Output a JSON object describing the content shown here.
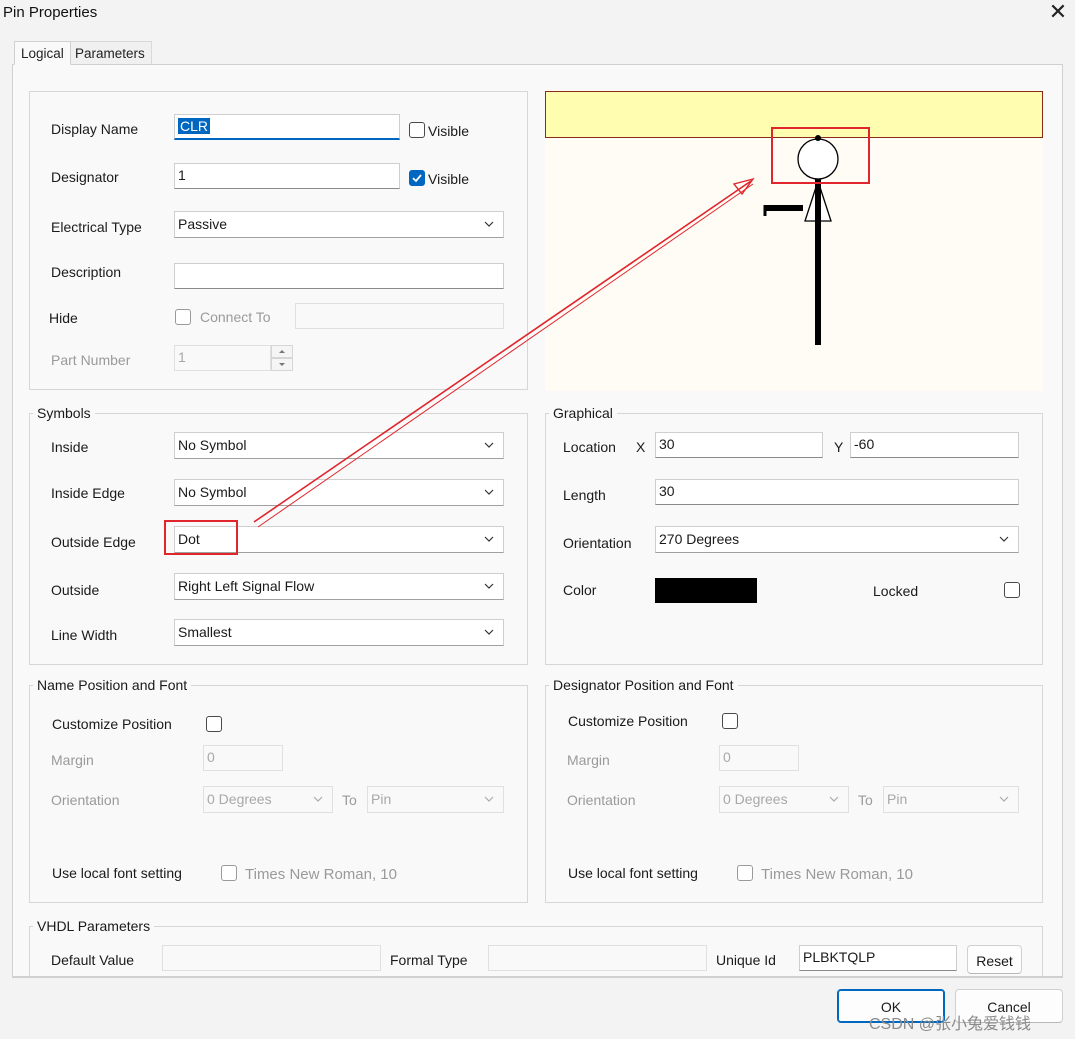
{
  "window": {
    "title": "Pin Properties",
    "close_glyph": "✕"
  },
  "tabs": [
    {
      "label": "Logical"
    },
    {
      "label": "Parameters"
    }
  ],
  "properties": {
    "display_name_label": "Display Name",
    "display_name_value": "CLR",
    "display_name_visible_label": "Visible",
    "designator_label": "Designator",
    "designator_value": "1",
    "designator_visible_label": "Visible",
    "electrical_type_label": "Electrical Type",
    "electrical_type_value": "Passive",
    "description_label": "Description",
    "description_value": "",
    "hide_label": "Hide",
    "connect_to_label": "Connect To",
    "connect_to_value": "",
    "part_number_label": "Part Number",
    "part_number_value": "1"
  },
  "symbols": {
    "title": "Symbols",
    "inside_label": "Inside",
    "inside_value": "No Symbol",
    "inside_edge_label": "Inside Edge",
    "inside_edge_value": "No Symbol",
    "outside_edge_label": "Outside Edge",
    "outside_edge_value": "Dot",
    "outside_label": "Outside",
    "outside_value": "Right Left Signal Flow",
    "line_width_label": "Line Width",
    "line_width_value": "Smallest"
  },
  "graphical": {
    "title": "Graphical",
    "location_label": "Location",
    "x_label": "X",
    "x_value": "30",
    "y_label": "Y",
    "y_value": "-60",
    "length_label": "Length",
    "length_value": "30",
    "orientation_label": "Orientation",
    "orientation_value": "270 Degrees",
    "color_label": "Color",
    "color_value": "#000000",
    "locked_label": "Locked"
  },
  "name_font": {
    "title": "Name Position and Font",
    "customize_label": "Customize Position",
    "margin_label": "Margin",
    "margin_value": "0",
    "orientation_label": "Orientation",
    "orientation_value": "0 Degrees",
    "to_label": "To",
    "to_value": "Pin",
    "local_font_label": "Use local font setting",
    "font_value": "Times New Roman, 10"
  },
  "designator_font": {
    "title": "Designator Position and Font",
    "customize_label": "Customize Position",
    "margin_label": "Margin",
    "margin_value": "0",
    "orientation_label": "Orientation",
    "orientation_value": "0 Degrees",
    "to_label": "To",
    "to_value": "Pin",
    "local_font_label": "Use local font setting",
    "font_value": "Times New Roman, 10"
  },
  "vhdl": {
    "title": "VHDL Parameters",
    "default_value_label": "Default Value",
    "default_value": "",
    "formal_type_label": "Formal Type",
    "formal_type_value": "",
    "unique_id_label": "Unique Id",
    "unique_id_value": "PLBKTQLP",
    "reset_label": "Reset"
  },
  "buttons": {
    "ok_label": "OK",
    "cancel_label": "Cancel"
  },
  "watermark": "CSDN @张小兔爱钱钱",
  "colors": {
    "accent": "#0067c0",
    "annotation": "#e0262c",
    "preview_band": "#fffdb0"
  }
}
